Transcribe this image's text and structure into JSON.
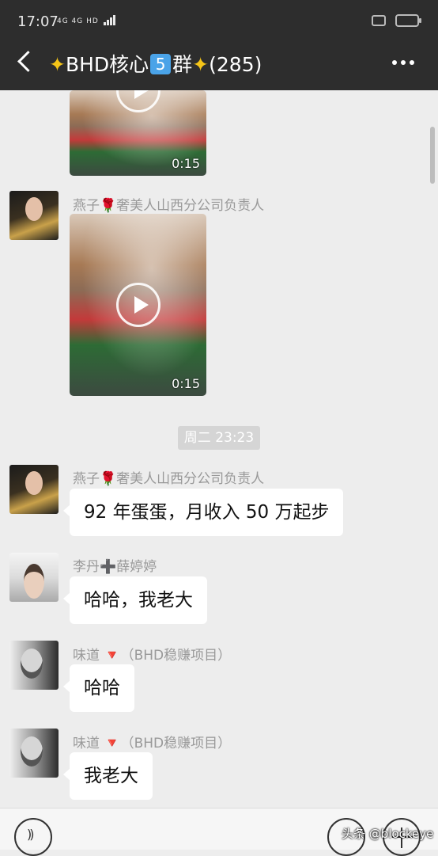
{
  "status": {
    "time": "17:07",
    "network": "4G 4G HD"
  },
  "header": {
    "title_left": "BHD核心",
    "badge": "5",
    "title_right": "群",
    "count": "(285)"
  },
  "messages": [
    {
      "type": "video",
      "duration": "0:15"
    },
    {
      "type": "video",
      "sender": "燕子🌹奢美人山西分公司负责人",
      "duration": "0:15"
    },
    {
      "type": "time",
      "text": "周二 23:23"
    },
    {
      "type": "text",
      "sender": "燕子🌹奢美人山西分公司负责人",
      "text": "92 年蛋蛋，月收入 50 万起步"
    },
    {
      "type": "text",
      "sender": "李丹➕薛婷婷",
      "text": "哈哈，我老大"
    },
    {
      "type": "text",
      "sender": "味道 🔻（BHD稳赚项目）",
      "text": "哈哈"
    },
    {
      "type": "text",
      "sender": "味道 🔻（BHD稳赚项目）",
      "text": "我老大"
    }
  ],
  "watermark": "头条 @blockeye"
}
